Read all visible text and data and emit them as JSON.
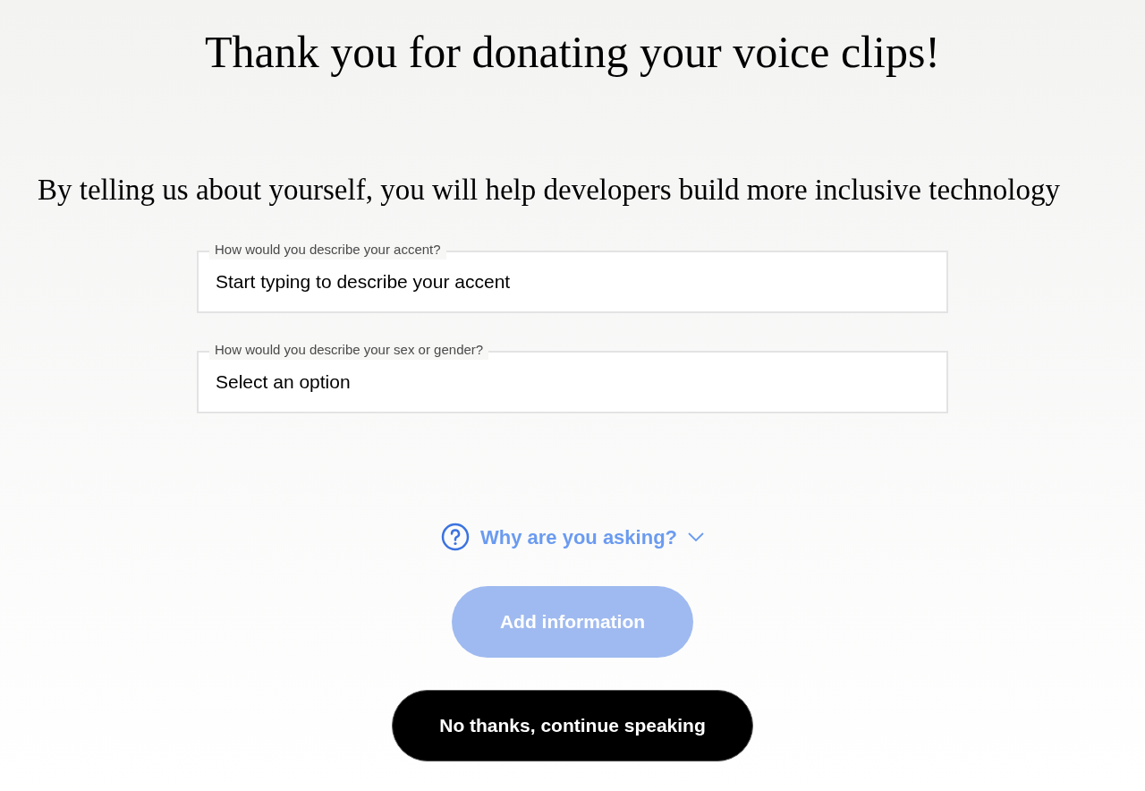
{
  "title": "Thank you for donating your voice clips!",
  "subtitle": "By telling us about yourself, you will help developers build more inclusive technology",
  "fields": [
    {
      "label": "How would you describe your accent?",
      "placeholder": "Start typing to describe your accent"
    },
    {
      "label": "How would you describe your sex or gender?",
      "placeholder": "Select an option"
    }
  ],
  "why_link": {
    "label": "Why are you asking?",
    "expanded": false
  },
  "buttons": [
    {
      "kind": "primary",
      "label": "Add information",
      "disabled": true
    },
    {
      "kind": "dark",
      "label": "No thanks, continue speaking",
      "disabled": false
    }
  ]
}
